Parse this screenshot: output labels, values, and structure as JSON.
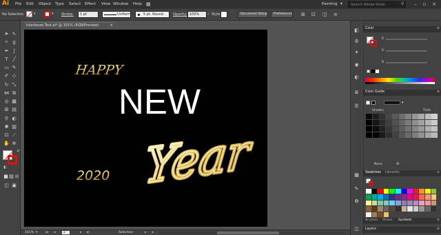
{
  "app": {
    "logo": "Ai",
    "menu": [
      "File",
      "Edit",
      "Object",
      "Type",
      "Select",
      "Effect",
      "View",
      "Window",
      "Help"
    ],
    "workspace": "Painting",
    "search_placeholder": "Search Adobe Stock"
  },
  "controlbar": {
    "selection_label": "No Selection",
    "stroke_label": "Stroke:",
    "stroke_weight": "1 pt",
    "profile": "Uniform",
    "brush": "5 pt. Round",
    "opacity_label": "Opacity:",
    "opacity_value": "100%",
    "style_label": "Style:",
    "doc_setup": "Document Setup",
    "preferences": "Preferences"
  },
  "document": {
    "tab_title": "Interlaced Text.ai* @ 101% (RGB/Preview)",
    "art": {
      "happy": "HAPPY",
      "new": "NEW",
      "year": "Year",
      "number": "2020"
    }
  },
  "statusbar": {
    "zoom": "101%",
    "artboard_num": "2",
    "tool": "Selection"
  },
  "panels": {
    "color": {
      "title": "Color"
    },
    "color_guide": {
      "title": "Color Guide",
      "shades": "Shades",
      "tints": "Tints",
      "none": "None"
    },
    "swatches": {
      "tab1": "Swatches",
      "tab2": "Libraries"
    },
    "brushes_row": {
      "brushes": "Brushes",
      "stroke": "Stroke",
      "symbols": "Symbols"
    },
    "layers": {
      "title": "Layers"
    }
  },
  "colors": {
    "gold": "#e7c35a",
    "accent": "#ff9a00"
  }
}
